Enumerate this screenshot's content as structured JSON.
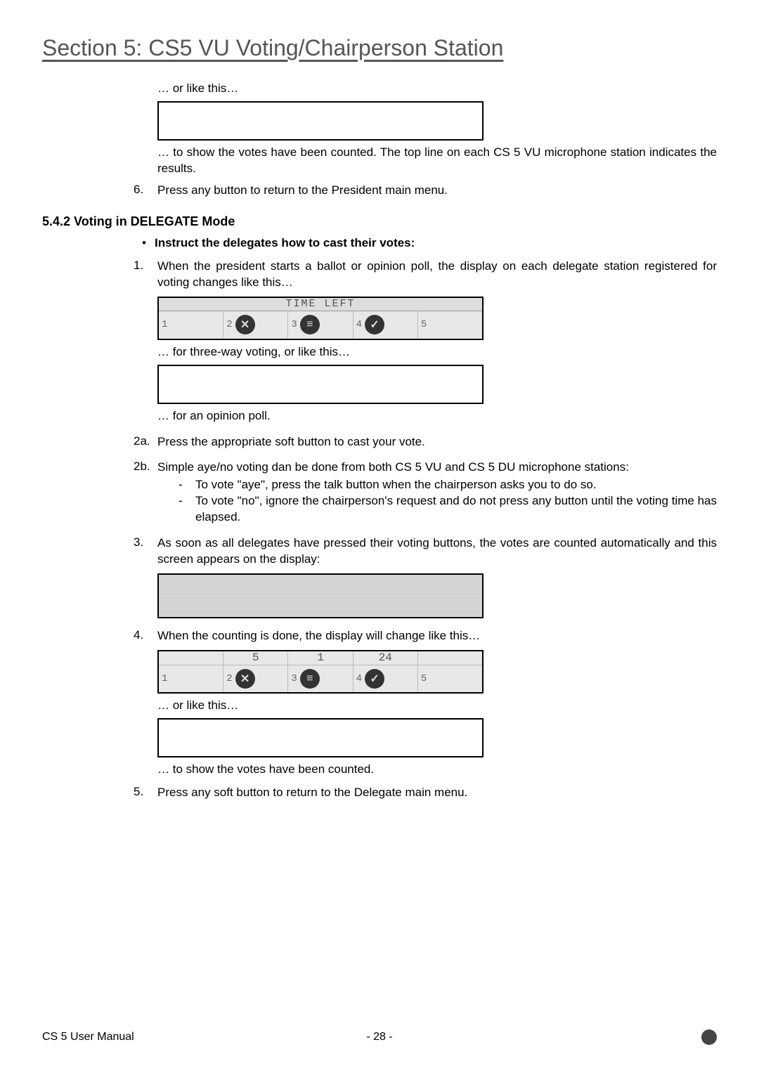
{
  "title": "Section 5: CS5 VU Voting/Chairperson Station",
  "p_orlike1": "… or like this…",
  "p_counted1": "… to show the votes have been counted. The top line on each CS 5 VU microphone station indicates the results.",
  "item6_num": "6.",
  "item6_txt": "Press any button to return to the President main menu.",
  "h542": "5.4.2 Voting in DELEGATE Mode",
  "bullet_txt": "Instruct the delegates how to cast their votes:",
  "item1_num": "1.",
  "item1_txt": "When the president starts a ballot or opinion poll, the display on each delegate station registered for voting changes like this…",
  "lcd_time_label": "TIME LEFT",
  "cells": {
    "c1": "1",
    "c2": "2",
    "c3": "3",
    "c4": "4",
    "c5": "5"
  },
  "p_three": "… for three-way voting, or like this…",
  "p_opinion": "… for an opinion poll.",
  "item2a_num": "2a.",
  "item2a_txt": "Press the appropriate soft button to cast your vote.",
  "item2b_num": "2b.",
  "item2b_txt": "Simple aye/no voting dan be done from both CS 5 VU and CS 5 DU microphone stations:",
  "dash_aye": "To vote \"aye\", press the talk button when the chairperson asks you to do so.",
  "dash_no": "To vote \"no\", ignore the chairperson's request and do not press any button until the voting time has elapsed.",
  "item3_num": "3.",
  "item3_txt": "As soon as all delegates have pressed their voting buttons, the votes are counted automatically and this screen appears on the display:",
  "item4_num": "4.",
  "item4_txt": "When the counting is done, the display will change like this…",
  "results_top": {
    "a": "",
    "b": "5",
    "c": "1",
    "d": "24",
    "e": ""
  },
  "p_orlike2": "… or like this…",
  "p_counted2": "… to show the votes have been counted.",
  "item5_num": "5.",
  "item5_txt": "Press any soft button to return to the Delegate main menu.",
  "footer_left": "CS 5 User Manual",
  "footer_center": "- 28 -",
  "icons": {
    "cross": "✕",
    "neutral": "≡",
    "check": "✓"
  }
}
